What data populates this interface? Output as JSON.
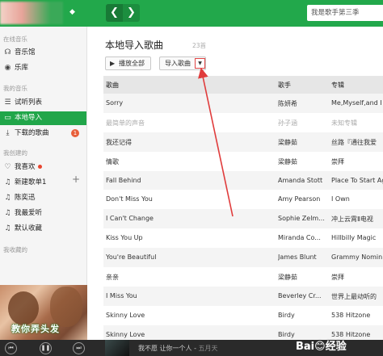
{
  "header": {
    "search_placeholder": "我是歌手第三季",
    "back_label": "❮",
    "forward_label": "❯"
  },
  "sidebar": {
    "section_online": "在线音乐",
    "items_online": [
      {
        "label": "音乐馆",
        "icon": "headphone-icon"
      },
      {
        "label": "乐库",
        "icon": "disc-icon"
      }
    ],
    "section_my": "我的音乐",
    "items_my": [
      {
        "label": "试听列表",
        "icon": "list-icon"
      },
      {
        "label": "本地导入",
        "icon": "monitor-icon"
      },
      {
        "label": "下载的歌曲",
        "icon": "download-icon",
        "badge": "1"
      }
    ],
    "section_created": "我创建的",
    "items_created": [
      {
        "label": "我喜欢",
        "icon": "heart-icon"
      },
      {
        "label": "新建歌单1",
        "icon": "note-icon"
      },
      {
        "label": "陈奕迅",
        "icon": "note-icon"
      },
      {
        "label": "我最爱听",
        "icon": "note-icon"
      },
      {
        "label": "默认收藏",
        "icon": "note-icon"
      }
    ],
    "section_collected": "我收藏的",
    "album_caption": "教你弄头发"
  },
  "main": {
    "title": "本地导入歌曲",
    "count": "23首",
    "play_all": "播放全部",
    "import_label": "导入歌曲",
    "columns": {
      "song": "歌曲",
      "singer": "歌手",
      "album": "专辑"
    },
    "rows": [
      {
        "song": "Sorry",
        "singer": "陈妍希",
        "album": "Me,Myself,and I"
      },
      {
        "song": "最简单的声音",
        "singer": "孙子涵",
        "album": "未知专辑",
        "dim": true
      },
      {
        "song": "我还记得",
        "singer": "梁静茹",
        "album": "丝路『通往我爱"
      },
      {
        "song": "情歌",
        "singer": "梁静茹",
        "album": "崇拜"
      },
      {
        "song": "Fall Behind",
        "singer": "Amanda Stott",
        "album": "Place To Start Ag"
      },
      {
        "song": "Don't Miss You",
        "singer": "Amy Pearson",
        "album": "I Own"
      },
      {
        "song": "I Can't Change",
        "singer": "Sophie Zelm...",
        "album": "冲上云霄Ⅱ电视"
      },
      {
        "song": "Kiss You Up",
        "singer": "Miranda Co...",
        "album": "Hillbilly Magic"
      },
      {
        "song": "You're Beautiful",
        "singer": "James Blunt",
        "album": "Grammy Nomin"
      },
      {
        "song": "亲亲",
        "singer": "梁静茹",
        "album": "崇拜"
      },
      {
        "song": "I Miss You",
        "singer": "Beverley Cr...",
        "album": "世界上最动听的"
      },
      {
        "song": "Skinny Love",
        "singer": "Birdy",
        "album": "538 Hitzone"
      },
      {
        "song": "Skinny Love",
        "singer": "Birdy",
        "album": "538 Hitzone"
      }
    ]
  },
  "player": {
    "now_playing": "我不愿 让你一个人",
    "artist": "五月天",
    "prev_label": "⏮",
    "pause_label": "❚❚",
    "next_label": "⏭"
  },
  "watermark": "Bai😊经验"
}
